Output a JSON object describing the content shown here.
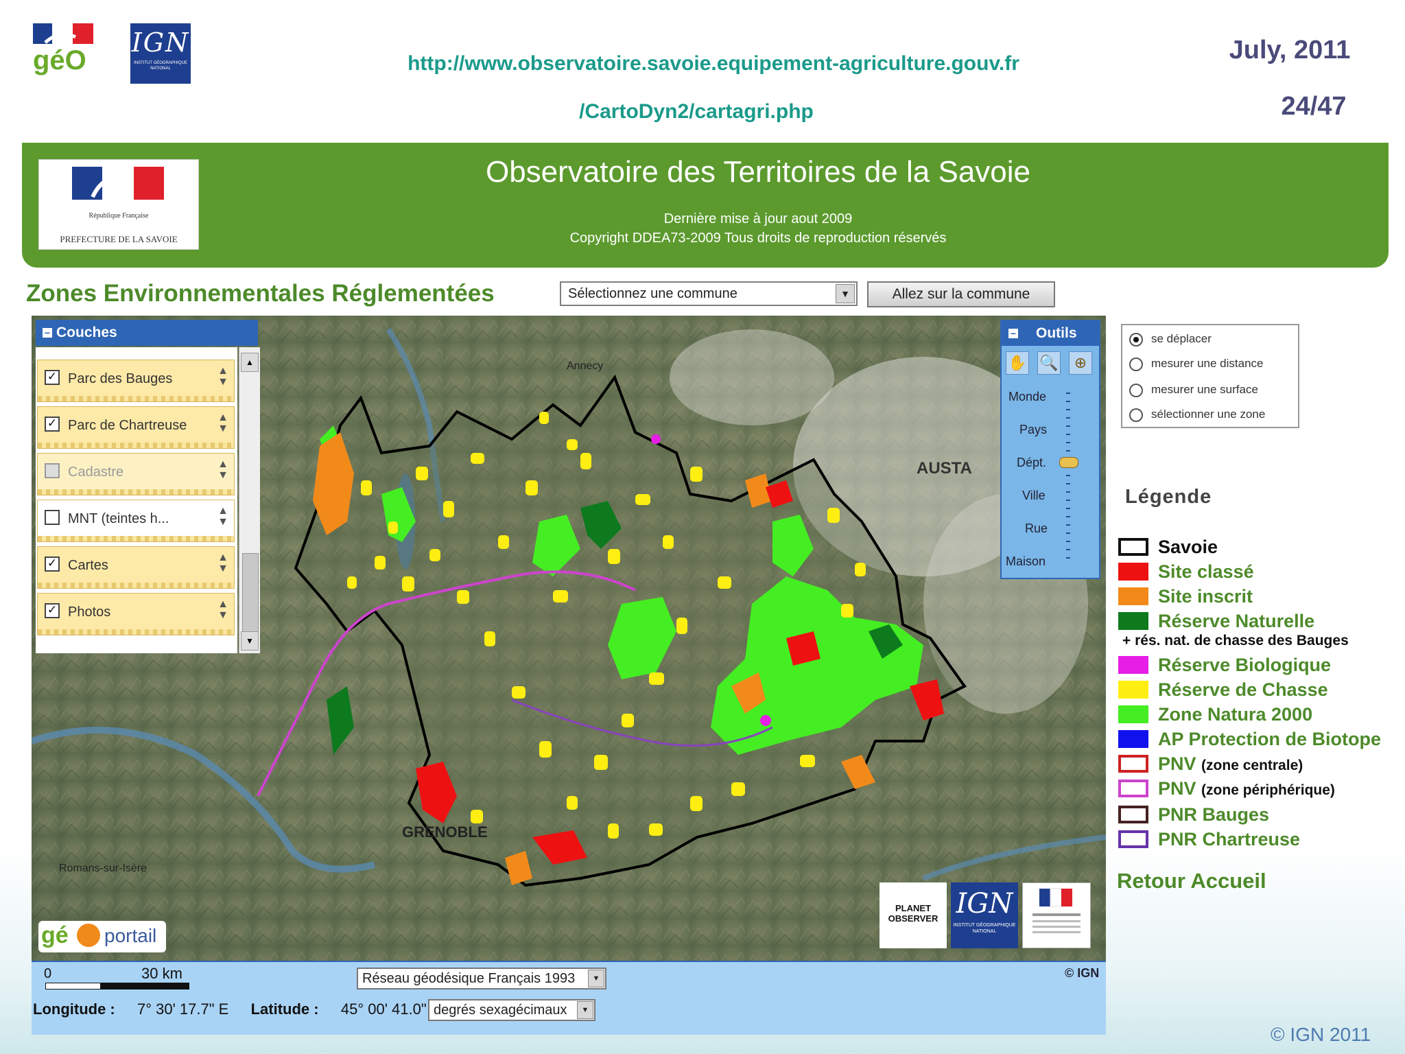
{
  "slide": {
    "url_line1": "http://www.observatoire.savoie.equipement-agriculture.gouv.fr",
    "url_line2": "/CartoDyn2/cartagri.php",
    "date": "July,  2011",
    "page": "24/47",
    "footer_copyright": "© IGN 2011",
    "logo_geo_text": "géO",
    "logo_ign_text": "IGN",
    "logo_ign_subtitle": "INSTITUT GÉOGRAPHIQUE NATIONAL"
  },
  "banner": {
    "title": "Observatoire des Territoires de la Savoie",
    "update": "Dernière mise à jour aout 2009",
    "copyright": "Copyright DDEA73-2009 Tous droits de reproduction réservés",
    "logo_republique": "République Française",
    "logo_prefecture": "PREFECTURE DE LA SAVOIE",
    "color": "#5c9a2e"
  },
  "toolbar": {
    "title": "Zones Environnementales Réglementées",
    "commune_select": "Sélectionnez une commune",
    "goto_button": "Allez sur la commune"
  },
  "couches": {
    "title": "Couches",
    "items": [
      {
        "label": "Parc des Bauges",
        "checked": true,
        "enabled": true
      },
      {
        "label": "Parc de Chartreuse",
        "checked": true,
        "enabled": true
      },
      {
        "label": "Cadastre",
        "checked": false,
        "enabled": false
      },
      {
        "label": "MNT (teintes h...",
        "checked": false,
        "enabled": true
      },
      {
        "label": "Cartes",
        "checked": true,
        "enabled": true
      },
      {
        "label": "Photos",
        "checked": true,
        "enabled": true
      }
    ]
  },
  "outils": {
    "title": "Outils",
    "tools": [
      "hand-icon",
      "zoom-in-icon",
      "zoom-extent-icon"
    ],
    "zoom_levels": [
      "Monde",
      "Pays",
      "Dépt.",
      "Ville",
      "Rue",
      "Maison"
    ],
    "zoom_selected": "Dépt."
  },
  "modes": {
    "items": [
      {
        "label": "se déplacer",
        "selected": true
      },
      {
        "label": "mesurer une distance",
        "selected": false
      },
      {
        "label": "mesurer une surface",
        "selected": false
      },
      {
        "label": "sélectionner une zone",
        "selected": false
      }
    ]
  },
  "legend": {
    "title": "Légende",
    "items": [
      {
        "label": "Savoie",
        "sub": "",
        "fill": "#ffffff",
        "border": "#111111",
        "text_color": "black"
      },
      {
        "label": "Site classé",
        "sub": "",
        "fill": "#ee1111",
        "border": "#ee1111",
        "text_color": "green"
      },
      {
        "label": "Site inscrit",
        "sub": "",
        "fill": "#f28a1a",
        "border": "#f28a1a",
        "text_color": "green"
      },
      {
        "label": "Réserve Naturelle",
        "sub": "",
        "fill": "#0e7a1e",
        "border": "#0e7a1e",
        "text_color": "green"
      },
      {
        "label": "Réserve Biologique",
        "sub": "",
        "fill": "#e61ee6",
        "border": "#e61ee6",
        "text_color": "green"
      },
      {
        "label": "Réserve de Chasse",
        "sub": "",
        "fill": "#ffee11",
        "border": "#ffee11",
        "text_color": "green"
      },
      {
        "label": "Zone Natura 2000",
        "sub": "",
        "fill": "#44ee22",
        "border": "#44ee22",
        "text_color": "green"
      },
      {
        "label": "AP Protection de Biotope",
        "sub": "",
        "fill": "#1111ee",
        "border": "#1111ee",
        "text_color": "green"
      },
      {
        "label": "PNV",
        "sub": "(zone centrale)",
        "fill": "#ffffff",
        "border": "#cc2222",
        "text_color": "green"
      },
      {
        "label": "PNV",
        "sub": "(zone périphérique)",
        "fill": "#ffffff",
        "border": "#cc44cc",
        "text_color": "green"
      },
      {
        "label": "PNR Bauges",
        "sub": "",
        "fill": "#ffffff",
        "border": "#442222",
        "text_color": "green"
      },
      {
        "label": "PNR Chartreuse",
        "sub": "",
        "fill": "#ffffff",
        "border": "#6633aa",
        "text_color": "green"
      }
    ],
    "note": "+ rés. nat. de chasse des Bauges",
    "retour": "Retour Accueil"
  },
  "map": {
    "place_labels": [
      "Annecy",
      "GRENOBLE",
      "AUSTA",
      "Romans-sur-Isère"
    ],
    "partner_planet": "PLANET OBSERVER",
    "partner_ign": "IGN",
    "geoportail_g": "gé",
    "geoportail_text": "portail"
  },
  "bottom": {
    "scale_zero": "0",
    "scale_label": "30 km",
    "reseau_select": "Réseau géodésique Français 1993",
    "ign_copyright": "© IGN",
    "longitude_label": "Longitude :",
    "longitude_value": "7° 30' 17.7\" E",
    "latitude_label": "Latitude :",
    "latitude_value": "45° 00' 41.0\" N",
    "degres_select": "degrés sexagécimaux"
  }
}
